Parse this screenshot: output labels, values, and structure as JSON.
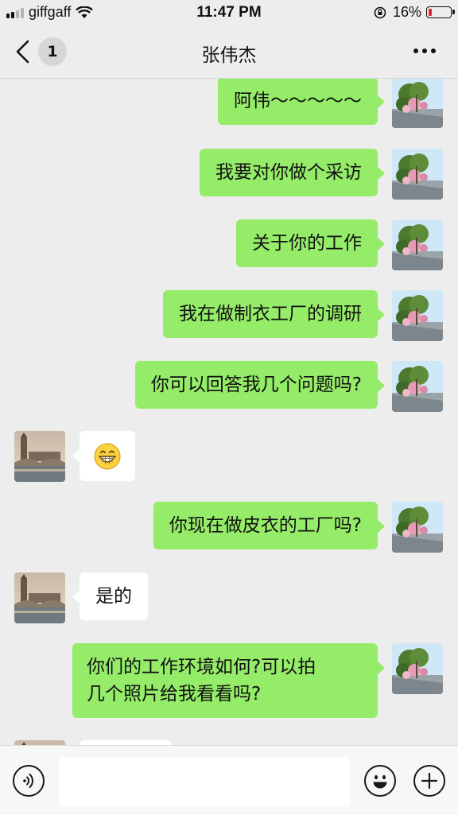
{
  "status_bar": {
    "carrier": "giffgaff",
    "time": "11:47 PM",
    "battery_percent": "16%",
    "battery_level": 0.16,
    "signal_bars": 2
  },
  "nav": {
    "unread_badge": "1",
    "title": "张伟杰"
  },
  "messages": [
    {
      "from": "me",
      "text": "阿伟～～～～～"
    },
    {
      "from": "me",
      "text": "我要对你做个采访"
    },
    {
      "from": "me",
      "text": "关于你的工作"
    },
    {
      "from": "me",
      "text": "我在做制衣工厂的调研"
    },
    {
      "from": "me",
      "text": "你可以回答我几个问题吗?"
    },
    {
      "from": "other",
      "type": "emoji",
      "emoji": "grinning-face-icon"
    },
    {
      "from": "me",
      "text": "你现在做皮衣的工厂吗?"
    },
    {
      "from": "other",
      "text": "是的"
    },
    {
      "from": "me",
      "lines": [
        "你们的工作环境如何?可以拍",
        "几个照片给我看看吗?"
      ]
    }
  ],
  "input": {
    "value": ""
  },
  "colors": {
    "my_bubble": "#95ec69",
    "other_bubble": "#ffffff",
    "background": "#ededed",
    "battery_low": "#e0262c"
  },
  "icons": {
    "voice": "voice-icon",
    "emoji": "emoji-icon",
    "plus": "plus-icon",
    "back": "chevron-left-icon",
    "more": "more-icon"
  }
}
